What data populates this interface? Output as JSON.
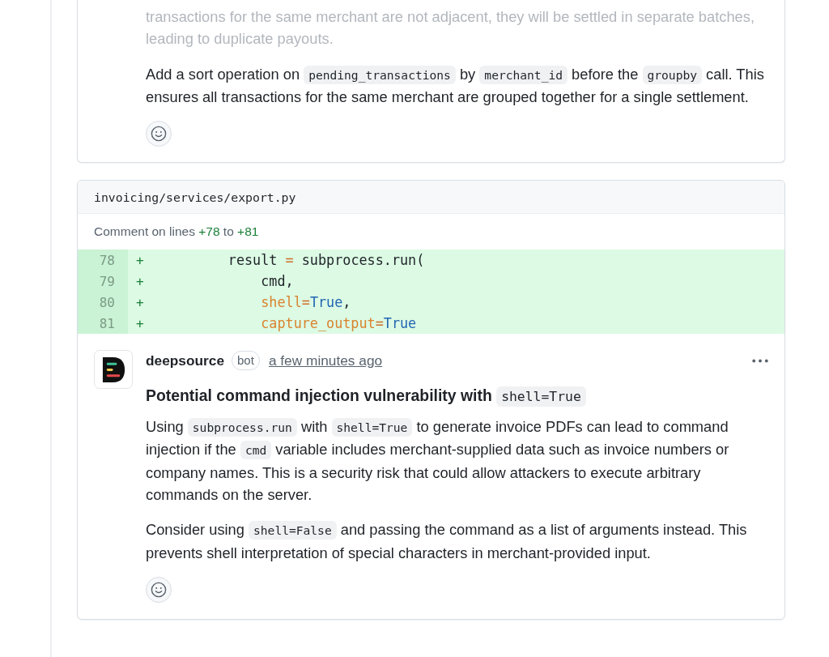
{
  "previous_comment": {
    "paragraphs": [
      {
        "faded": true,
        "segments": [
          {
            "kind": "text",
            "text": "transactions for the same merchant are not adjacent, they will be settled in separate batches, leading to duplicate payouts."
          }
        ]
      },
      {
        "faded": false,
        "segments": [
          {
            "kind": "text",
            "text": "Add a sort operation on "
          },
          {
            "kind": "code",
            "text": "pending_transactions"
          },
          {
            "kind": "text",
            "text": " by "
          },
          {
            "kind": "code",
            "text": "merchant_id"
          },
          {
            "kind": "text",
            "text": " before the "
          },
          {
            "kind": "code",
            "text": "groupby"
          },
          {
            "kind": "text",
            "text": " call. This ensures all transactions for the same merchant are grouped together for a single settlement."
          }
        ]
      }
    ]
  },
  "review_thread": {
    "file_path": "invoicing/services/export.py",
    "comment_range": [
      {
        "kind": "text",
        "text": "Comment on lines "
      },
      {
        "kind": "line",
        "text": "+78"
      },
      {
        "kind": "text",
        "text": " to "
      },
      {
        "kind": "line",
        "text": "+81"
      }
    ],
    "diff_lines": [
      {
        "number": "78",
        "sign": "+",
        "tokens": [
          {
            "kind": "plain",
            "text": "result "
          },
          {
            "kind": "operator",
            "text": "="
          },
          {
            "kind": "plain",
            "text": " subprocess.run("
          }
        ],
        "children": [
          {
            "number": "79",
            "sign": "+",
            "tokens": [
              {
                "kind": "plain",
                "text": "cmd,"
              }
            ]
          },
          {
            "number": "80",
            "sign": "+",
            "tokens": [
              {
                "kind": "param",
                "text": "shell"
              },
              {
                "kind": "operator",
                "text": "="
              },
              {
                "kind": "constant",
                "text": "True"
              },
              {
                "kind": "plain",
                "text": ","
              }
            ]
          },
          {
            "number": "81",
            "sign": "+",
            "tokens": [
              {
                "kind": "param",
                "text": "capture_output"
              },
              {
                "kind": "operator",
                "text": "="
              },
              {
                "kind": "constant",
                "text": "True"
              }
            ]
          }
        ]
      }
    ],
    "comment": {
      "author": "deepsource",
      "badge": "bot",
      "time": "a few minutes ago",
      "title": [
        {
          "kind": "text",
          "text": "Potential command injection vulnerability with "
        },
        {
          "kind": "code",
          "text": "shell=True"
        }
      ],
      "paragraphs": [
        {
          "segments": [
            {
              "kind": "text",
              "text": "Using "
            },
            {
              "kind": "code",
              "text": "subprocess.run"
            },
            {
              "kind": "text",
              "text": " with "
            },
            {
              "kind": "code",
              "text": "shell=True"
            },
            {
              "kind": "text",
              "text": " to generate invoice PDFs can lead to command injection if the "
            },
            {
              "kind": "code",
              "text": "cmd"
            },
            {
              "kind": "text",
              "text": " variable includes merchant-supplied data such as invoice numbers or company names. This is a security risk that could allow attackers to execute arbitrary commands on the server."
            }
          ]
        },
        {
          "segments": [
            {
              "kind": "text",
              "text": "Consider using "
            },
            {
              "kind": "code",
              "text": "shell=False"
            },
            {
              "kind": "text",
              "text": " and passing the command as a list of arguments instead. This prevents shell interpretation of special characters in merchant-provided input."
            }
          ]
        }
      ]
    }
  }
}
